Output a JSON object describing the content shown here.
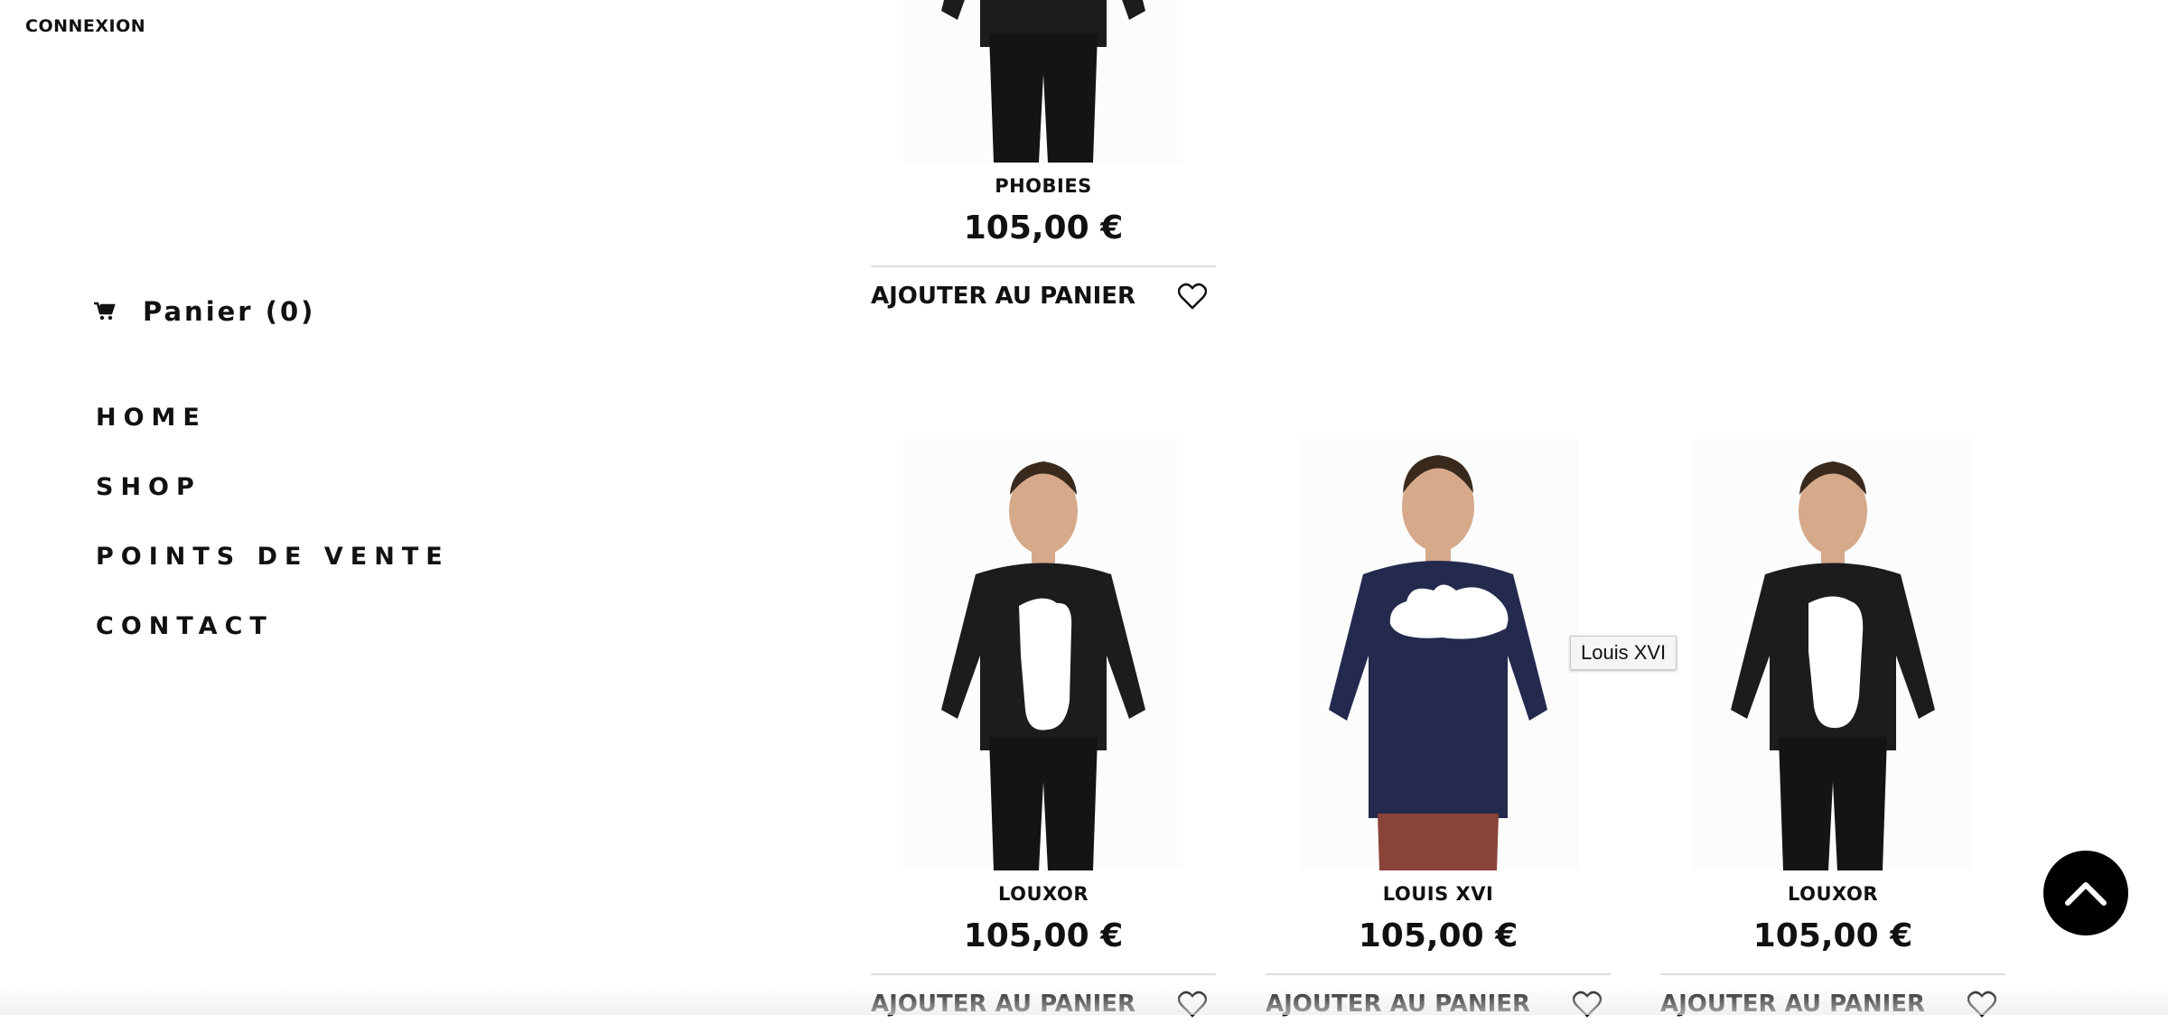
{
  "header": {
    "login_label": "CONNEXION"
  },
  "sidebar": {
    "cart_label": "Panier (0)",
    "nav": [
      {
        "label": "HOME"
      },
      {
        "label": "SHOP"
      },
      {
        "label": "POINTS DE VENTE"
      },
      {
        "label": "CONTACT"
      }
    ]
  },
  "products": [
    {
      "name": "PHOBIES",
      "price": "105,00 €",
      "add_label": "AJOUTER AU PANIER",
      "sweater_color": "#1c1c1e"
    },
    {
      "name": "LOUXOR",
      "price": "105,00 €",
      "add_label": "AJOUTER AU PANIER",
      "sweater_color": "#1c1c1e"
    },
    {
      "name": "LOUIS XVI",
      "price": "105,00 €",
      "add_label": "AJOUTER AU PANIER",
      "sweater_color": "#232a4e"
    },
    {
      "name": "LOUXOR",
      "price": "105,00 €",
      "add_label": "AJOUTER AU PANIER",
      "sweater_color": "#1c1c1e"
    }
  ],
  "tooltip": {
    "text": "Louis XVI"
  },
  "icons": {
    "cart": "cart-icon",
    "heart": "heart-icon",
    "back_to_top": "chevron-up-icon"
  }
}
